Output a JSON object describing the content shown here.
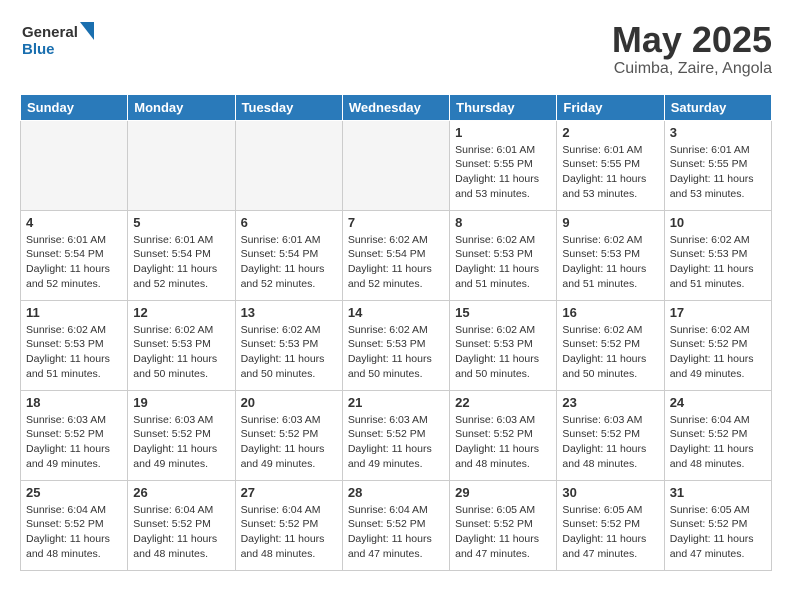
{
  "header": {
    "logo_general": "General",
    "logo_blue": "Blue",
    "title": "May 2025",
    "location": "Cuimba, Zaire, Angola"
  },
  "weekdays": [
    "Sunday",
    "Monday",
    "Tuesday",
    "Wednesday",
    "Thursday",
    "Friday",
    "Saturday"
  ],
  "weeks": [
    [
      {
        "day": "",
        "info": ""
      },
      {
        "day": "",
        "info": ""
      },
      {
        "day": "",
        "info": ""
      },
      {
        "day": "",
        "info": ""
      },
      {
        "day": "1",
        "info": "Sunrise: 6:01 AM\nSunset: 5:55 PM\nDaylight: 11 hours\nand 53 minutes."
      },
      {
        "day": "2",
        "info": "Sunrise: 6:01 AM\nSunset: 5:55 PM\nDaylight: 11 hours\nand 53 minutes."
      },
      {
        "day": "3",
        "info": "Sunrise: 6:01 AM\nSunset: 5:55 PM\nDaylight: 11 hours\nand 53 minutes."
      }
    ],
    [
      {
        "day": "4",
        "info": "Sunrise: 6:01 AM\nSunset: 5:54 PM\nDaylight: 11 hours\nand 52 minutes."
      },
      {
        "day": "5",
        "info": "Sunrise: 6:01 AM\nSunset: 5:54 PM\nDaylight: 11 hours\nand 52 minutes."
      },
      {
        "day": "6",
        "info": "Sunrise: 6:01 AM\nSunset: 5:54 PM\nDaylight: 11 hours\nand 52 minutes."
      },
      {
        "day": "7",
        "info": "Sunrise: 6:02 AM\nSunset: 5:54 PM\nDaylight: 11 hours\nand 52 minutes."
      },
      {
        "day": "8",
        "info": "Sunrise: 6:02 AM\nSunset: 5:53 PM\nDaylight: 11 hours\nand 51 minutes."
      },
      {
        "day": "9",
        "info": "Sunrise: 6:02 AM\nSunset: 5:53 PM\nDaylight: 11 hours\nand 51 minutes."
      },
      {
        "day": "10",
        "info": "Sunrise: 6:02 AM\nSunset: 5:53 PM\nDaylight: 11 hours\nand 51 minutes."
      }
    ],
    [
      {
        "day": "11",
        "info": "Sunrise: 6:02 AM\nSunset: 5:53 PM\nDaylight: 11 hours\nand 51 minutes."
      },
      {
        "day": "12",
        "info": "Sunrise: 6:02 AM\nSunset: 5:53 PM\nDaylight: 11 hours\nand 50 minutes."
      },
      {
        "day": "13",
        "info": "Sunrise: 6:02 AM\nSunset: 5:53 PM\nDaylight: 11 hours\nand 50 minutes."
      },
      {
        "day": "14",
        "info": "Sunrise: 6:02 AM\nSunset: 5:53 PM\nDaylight: 11 hours\nand 50 minutes."
      },
      {
        "day": "15",
        "info": "Sunrise: 6:02 AM\nSunset: 5:53 PM\nDaylight: 11 hours\nand 50 minutes."
      },
      {
        "day": "16",
        "info": "Sunrise: 6:02 AM\nSunset: 5:52 PM\nDaylight: 11 hours\nand 50 minutes."
      },
      {
        "day": "17",
        "info": "Sunrise: 6:02 AM\nSunset: 5:52 PM\nDaylight: 11 hours\nand 49 minutes."
      }
    ],
    [
      {
        "day": "18",
        "info": "Sunrise: 6:03 AM\nSunset: 5:52 PM\nDaylight: 11 hours\nand 49 minutes."
      },
      {
        "day": "19",
        "info": "Sunrise: 6:03 AM\nSunset: 5:52 PM\nDaylight: 11 hours\nand 49 minutes."
      },
      {
        "day": "20",
        "info": "Sunrise: 6:03 AM\nSunset: 5:52 PM\nDaylight: 11 hours\nand 49 minutes."
      },
      {
        "day": "21",
        "info": "Sunrise: 6:03 AM\nSunset: 5:52 PM\nDaylight: 11 hours\nand 49 minutes."
      },
      {
        "day": "22",
        "info": "Sunrise: 6:03 AM\nSunset: 5:52 PM\nDaylight: 11 hours\nand 48 minutes."
      },
      {
        "day": "23",
        "info": "Sunrise: 6:03 AM\nSunset: 5:52 PM\nDaylight: 11 hours\nand 48 minutes."
      },
      {
        "day": "24",
        "info": "Sunrise: 6:04 AM\nSunset: 5:52 PM\nDaylight: 11 hours\nand 48 minutes."
      }
    ],
    [
      {
        "day": "25",
        "info": "Sunrise: 6:04 AM\nSunset: 5:52 PM\nDaylight: 11 hours\nand 48 minutes."
      },
      {
        "day": "26",
        "info": "Sunrise: 6:04 AM\nSunset: 5:52 PM\nDaylight: 11 hours\nand 48 minutes."
      },
      {
        "day": "27",
        "info": "Sunrise: 6:04 AM\nSunset: 5:52 PM\nDaylight: 11 hours\nand 48 minutes."
      },
      {
        "day": "28",
        "info": "Sunrise: 6:04 AM\nSunset: 5:52 PM\nDaylight: 11 hours\nand 47 minutes."
      },
      {
        "day": "29",
        "info": "Sunrise: 6:05 AM\nSunset: 5:52 PM\nDaylight: 11 hours\nand 47 minutes."
      },
      {
        "day": "30",
        "info": "Sunrise: 6:05 AM\nSunset: 5:52 PM\nDaylight: 11 hours\nand 47 minutes."
      },
      {
        "day": "31",
        "info": "Sunrise: 6:05 AM\nSunset: 5:52 PM\nDaylight: 11 hours\nand 47 minutes."
      }
    ]
  ]
}
